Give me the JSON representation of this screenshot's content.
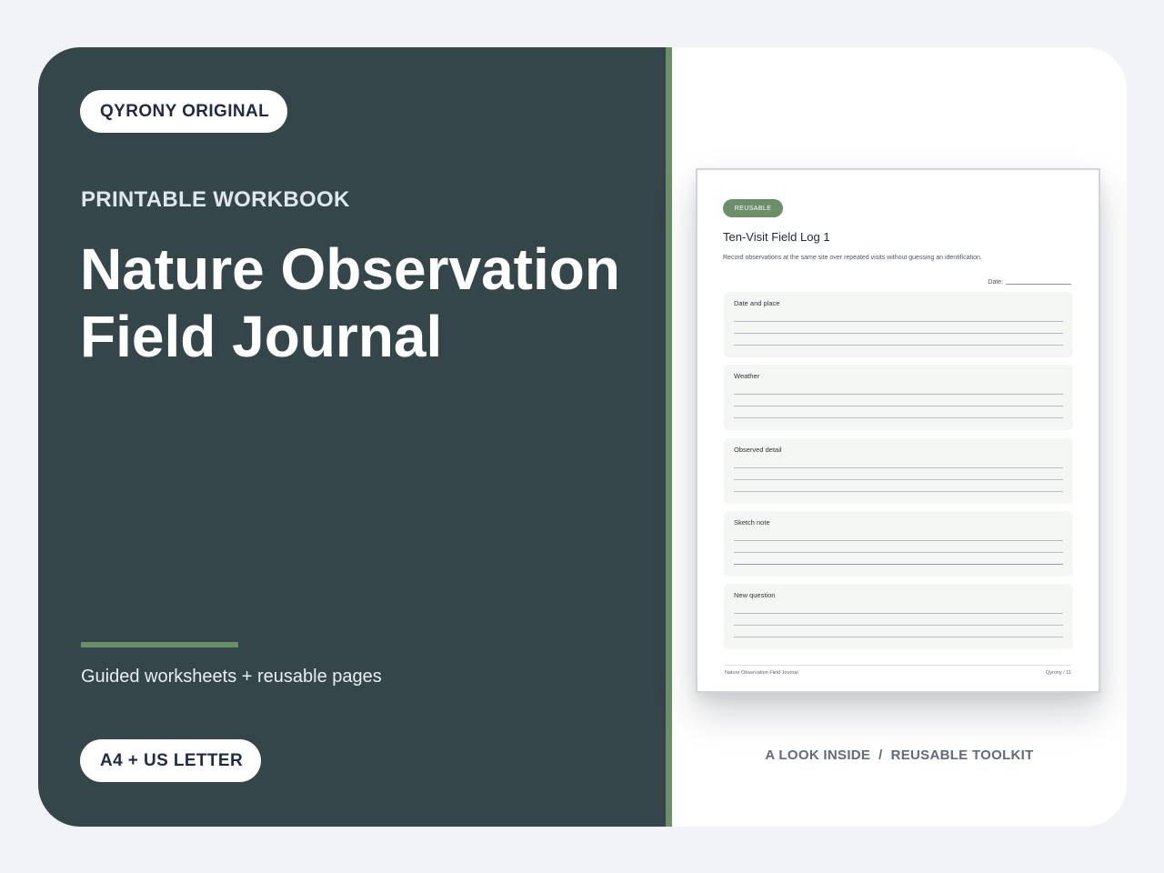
{
  "cover": {
    "brand_badge": "QYRONY ORIGINAL",
    "kicker": "PRINTABLE WORKBOOK",
    "title": "Nature Observation Field Journal",
    "subtitle": "Guided worksheets + reusable pages",
    "format_badge": "A4 + US LETTER"
  },
  "preview": {
    "tag": "REUSABLE",
    "title": "Ten-Visit Field Log 1",
    "description": "Record observations at the same site over repeated visits without guessing an identification.",
    "date_label": "Date:",
    "fields": [
      {
        "label": "Date and place"
      },
      {
        "label": "Weather"
      },
      {
        "label": "Observed detail"
      },
      {
        "label": "Sketch note"
      },
      {
        "label": "New question"
      }
    ],
    "footer_left": "Nature Observation Field Journal",
    "footer_right": "Qyrony / 11",
    "caption": "A LOOK INSIDE  /  REUSABLE TOOLKIT"
  },
  "colors": {
    "panel": "#34464a",
    "accent_green": "#6a8f69",
    "background": "#f1f3f6"
  }
}
